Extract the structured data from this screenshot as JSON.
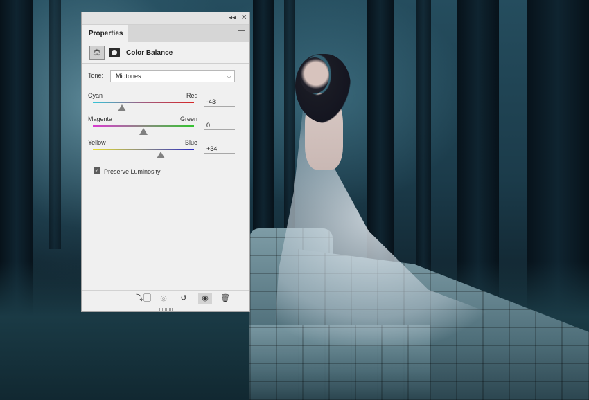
{
  "panel": {
    "tab_label": "Properties",
    "collapse_glyph": "◂◂",
    "close_glyph": "✕",
    "adjustment_title": "Color Balance",
    "adjustment_icon": "balance-scale-icon",
    "tone": {
      "label": "Tone:",
      "value": "Midtones"
    },
    "sliders": [
      {
        "left_label": "Cyan",
        "right_label": "Red",
        "value": "-43",
        "level": -43
      },
      {
        "left_label": "Magenta",
        "right_label": "Green",
        "value": "0",
        "level": 0
      },
      {
        "left_label": "Yellow",
        "right_label": "Blue",
        "value": "+34",
        "level": 34
      }
    ],
    "preserve_luminosity": {
      "label": "Preserve Luminosity",
      "checked": true
    },
    "footer_buttons": [
      "clip-to-layer-icon",
      "view-previous-icon",
      "reset-icon",
      "visibility-eye-icon",
      "trash-icon"
    ]
  }
}
